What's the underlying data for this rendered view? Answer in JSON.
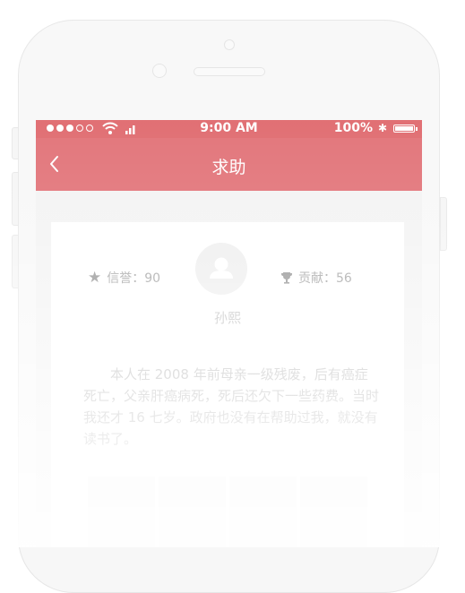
{
  "status_bar": {
    "time": "9:00 AM",
    "battery": "100%",
    "signal_icon": "signal-dots-icon",
    "wifi_icon": "wifi-icon",
    "bluetooth_icon": "bluetooth-icon"
  },
  "nav": {
    "title": "求助",
    "back_icon": "chevron-left-icon"
  },
  "profile": {
    "reputation": "信誉：90",
    "contribution": "贡献：56",
    "name": "孙熙",
    "bio": "本人在 2008 年前母亲一级残废，后有癌症死亡，父亲肝癌病死，死后还欠下一些药费。当时我还才 16 七岁。政府也没有在帮助过我，就没有读书了。"
  },
  "colors": {
    "accent": "#dc5a5f",
    "status_bar": "#dc5a5f",
    "nav_bar": "#de6268"
  }
}
